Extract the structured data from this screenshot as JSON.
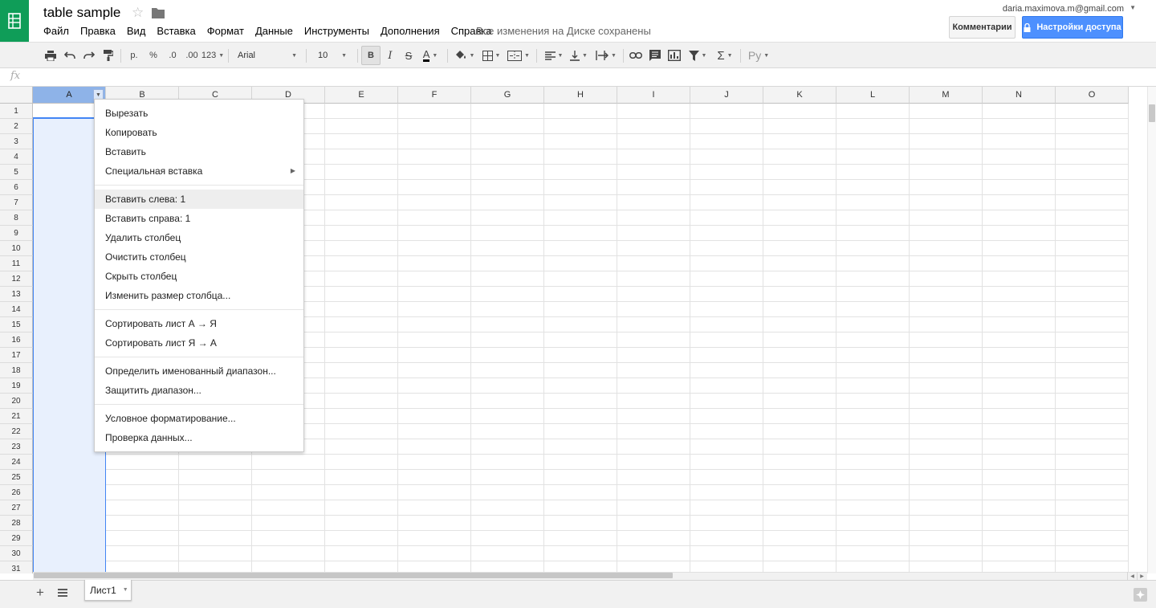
{
  "header": {
    "title": "table sample",
    "menu": [
      "Файл",
      "Правка",
      "Вид",
      "Вставка",
      "Формат",
      "Данные",
      "Инструменты",
      "Дополнения",
      "Справка"
    ],
    "save_status": "Все изменения на Диске сохранены",
    "user_email": "daria.maximova.m@gmail.com",
    "comments_label": "Комментарии",
    "share_label": "Настройки доступа",
    "brand_color": "#0f9d58",
    "share_color": "#4d90fe"
  },
  "toolbar": {
    "currency_label": "р.",
    "percent_label": "%",
    "decimal_decrease_label": ".0",
    "decimal_increase_label": ".00",
    "more_formats_label": "123",
    "font": "Arial",
    "font_size": "10",
    "bold_label": "B",
    "italic_label": "I",
    "strike_label": "S",
    "text_color_label": "A",
    "input_tools_label": "Ру"
  },
  "formula_bar": {
    "fx_label": "fx"
  },
  "grid": {
    "columns": [
      "A",
      "B",
      "C",
      "D",
      "E",
      "F",
      "G",
      "H",
      "I",
      "J",
      "K",
      "L",
      "M",
      "N",
      "O"
    ],
    "rows": [
      "1",
      "2",
      "3",
      "4",
      "5",
      "6",
      "7",
      "8",
      "9",
      "10",
      "11",
      "12",
      "13",
      "14",
      "15",
      "16",
      "17",
      "18",
      "19",
      "20",
      "21",
      "22",
      "23",
      "24",
      "25",
      "26",
      "27",
      "28",
      "29",
      "30",
      "31"
    ],
    "selected_column": "A",
    "selection_color": "#4285f4"
  },
  "context_menu": {
    "groups": [
      [
        {
          "label": "Вырезать"
        },
        {
          "label": "Копировать"
        },
        {
          "label": "Вставить"
        },
        {
          "label": "Специальная вставка",
          "submenu": true
        }
      ],
      [
        {
          "label": "Вставить слева: 1",
          "hover": true
        },
        {
          "label": "Вставить справа: 1"
        },
        {
          "label": "Удалить столбец"
        },
        {
          "label": "Очистить столбец"
        },
        {
          "label": "Скрыть столбец"
        },
        {
          "label": "Изменить размер столбца..."
        }
      ],
      [
        {
          "label": "Сортировать лист А → Я"
        },
        {
          "label": "Сортировать лист Я → А"
        }
      ],
      [
        {
          "label": "Определить именованный диапазон..."
        },
        {
          "label": "Защитить диапазон..."
        }
      ],
      [
        {
          "label": "Условное форматирование..."
        },
        {
          "label": "Проверка данных..."
        }
      ]
    ]
  },
  "sheets": {
    "tabs": [
      "Лист1"
    ]
  }
}
